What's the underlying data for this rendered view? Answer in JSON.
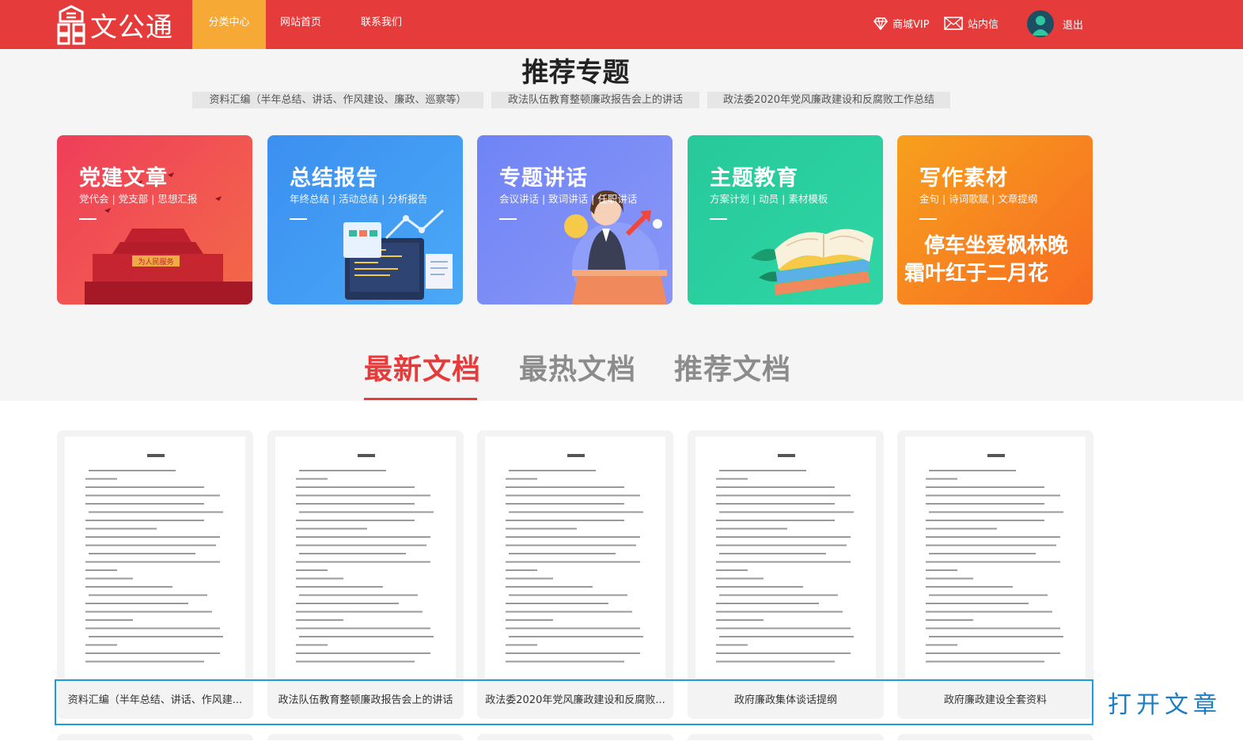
{
  "header": {
    "logo_text": "文公通",
    "nav": [
      {
        "label": "分类中心",
        "active": true
      },
      {
        "label": "网站首页",
        "active": false
      },
      {
        "label": "联系我们",
        "active": false
      }
    ],
    "vip_label": "商城VIP",
    "message_label": "站内信",
    "logout_label": "退出",
    "brand_color": "#e63b3b",
    "active_nav_color": "#f7a935"
  },
  "topics": {
    "title": "推荐专题",
    "tags": [
      "资料汇编（半年总结、讲话、作风建设、廉政、巡察等）",
      "政法队伍教育整顿廉政报告会上的讲话",
      "政法委2020年党风廉政建设和反腐败工作总结"
    ]
  },
  "categories": [
    {
      "title": "党建文章",
      "sub": "党代会 | 党支部 | 思想汇报",
      "banner": "为人民服务",
      "colors": [
        "#f0425a",
        "#f36a48"
      ]
    },
    {
      "title": "总结报告",
      "sub": "年终总结 | 活动总结 | 分析报告",
      "colors": [
        "#3c8ff0",
        "#4aa9f7"
      ]
    },
    {
      "title": "专题讲话",
      "sub": "会议讲话 | 致词讲话 | 任职讲话",
      "colors": [
        "#6f84f5",
        "#8a97f7"
      ]
    },
    {
      "title": "主题教育",
      "sub": "方案计划 | 动员 | 素材模板",
      "colors": [
        "#27c99a",
        "#2fd6a4"
      ]
    },
    {
      "title": "写作素材",
      "sub": "金句 | 诗词歌赋 | 文章提纲",
      "poem": [
        "停车坐爱枫林晚",
        "霜叶红于二月花"
      ],
      "colors": [
        "#f7941d",
        "#f76b22"
      ]
    }
  ],
  "doc_tabs": [
    {
      "label": "最新文档",
      "active": true
    },
    {
      "label": "最热文档",
      "active": false
    },
    {
      "label": "推荐文档",
      "active": false
    }
  ],
  "documents": [
    {
      "name": "资料汇编（半年总结、讲话、作风建..."
    },
    {
      "name": "政法队伍教育整顿廉政报告会上的讲话"
    },
    {
      "name": "政法委2020年党风廉政建设和反腐败..."
    },
    {
      "name": "政府廉政集体谈话提纲"
    },
    {
      "name": "政府廉政建设全套资料"
    }
  ],
  "annotation": {
    "label": "打开文章",
    "color": "#1a9ee0"
  }
}
